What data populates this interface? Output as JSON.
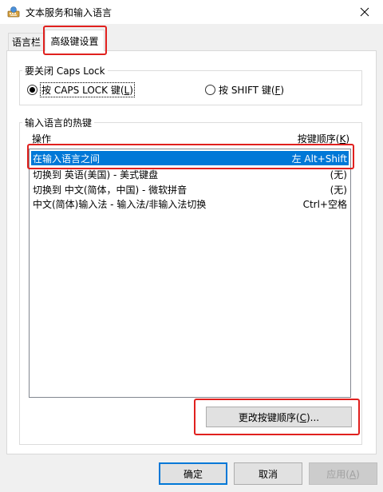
{
  "window": {
    "title": "文本服务和输入语言",
    "icon": "keyboard-globe-icon"
  },
  "tabs": [
    {
      "label": "语言栏"
    },
    {
      "label": "高级键设置",
      "active": true
    }
  ],
  "caps_group": {
    "legend": "要关闭 Caps Lock",
    "option1": {
      "pre": "按 CAPS LOCK 键(",
      "key": "L",
      "post": ")",
      "checked": true
    },
    "option2": {
      "pre": "按 SHIFT 键(",
      "key": "F",
      "post": ")",
      "checked": false
    }
  },
  "hotkey_group": {
    "legend": "输入语言的热键",
    "col_action": "操作",
    "col_order_pre": "按键顺序(",
    "col_order_key": "K",
    "col_order_post": ")",
    "rows": [
      {
        "action": "在输入语言之间",
        "keys": "左 Alt+Shift",
        "selected": true
      },
      {
        "action": "切换到 英语(美国) - 美式键盘",
        "keys": "(无)",
        "selected": false
      },
      {
        "action": "切换到 中文(简体，中国) - 微软拼音",
        "keys": "(无)",
        "selected": false
      },
      {
        "action": "中文(简体)输入法 - 输入法/非输入法切换",
        "keys": "Ctrl+空格",
        "selected": false
      }
    ],
    "change_button": {
      "pre": "更改按键顺序(",
      "key": "C",
      "post": ")..."
    }
  },
  "buttons": {
    "ok": "确定",
    "cancel": "取消",
    "apply_pre": "应用(",
    "apply_key": "A",
    "apply_post": ")"
  },
  "colors": {
    "highlight": "#0078d7",
    "annotation_red": "#e0201e"
  }
}
